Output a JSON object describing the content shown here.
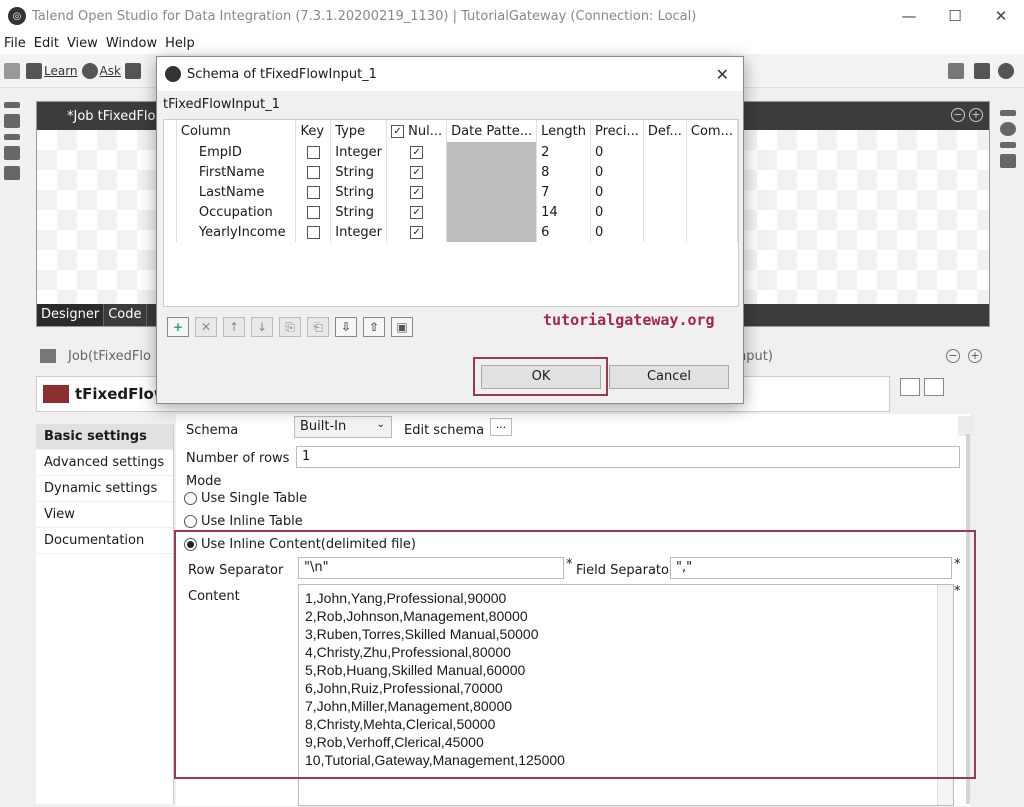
{
  "window": {
    "title": "Talend Open Studio for Data Integration (7.3.1.20200219_1130) | TutorialGateway (Connection: Local)",
    "minimize": "—",
    "maximize": "☐",
    "close": "✕"
  },
  "menu": [
    "File",
    "Edit",
    "View",
    "Window",
    "Help"
  ],
  "toolbar": {
    "learn": "Learn",
    "ask": "Ask"
  },
  "designer": {
    "tab_title": "*Job tFixedFlo",
    "tabs": [
      "Designer",
      "Code"
    ]
  },
  "component": {
    "job_label": "Job(tFixedFlo",
    "job_label_tail": "nput)",
    "title": "tFixedFlow"
  },
  "nav": [
    "Basic settings",
    "Advanced settings",
    "Dynamic settings",
    "View",
    "Documentation"
  ],
  "settings": {
    "schema_label": "Schema",
    "schema_value": "Built-In",
    "edit_schema": "Edit schema",
    "edit_schema_btn": "...",
    "rows_label": "Number of rows",
    "rows_value": "1",
    "mode_label": "Mode",
    "mode_options": [
      "Use Single Table",
      "Use Inline Table",
      "Use Inline Content(delimited file)"
    ],
    "row_sep_label": "Row Separator",
    "row_sep_value": "\"\\n\"",
    "field_sep_label": "Field Separator",
    "field_sep_value": "\",\"",
    "content_label": "Content",
    "required_mark": "*",
    "content_lines": [
      "1,John,Yang,Professional,90000",
      "2,Rob,Johnson,Management,80000",
      "3,Ruben,Torres,Skilled Manual,50000",
      "4,Christy,Zhu,Professional,80000",
      "5,Rob,Huang,Skilled Manual,60000",
      "6,John,Ruiz,Professional,70000",
      "7,John,Miller,Management,80000",
      "8,Christy,Mehta,Clerical,50000",
      "9,Rob,Verhoff,Clerical,45000",
      "10,Tutorial,Gateway,Management,125000"
    ]
  },
  "dialog": {
    "title": "Schema of tFixedFlowInput_1",
    "subtitle": "tFixedFlowInput_1",
    "close": "✕",
    "columns": [
      "Column",
      "Key",
      "Type",
      "Nul...",
      "Date Patte...",
      "Length",
      "Preci...",
      "Def...",
      "Com..."
    ],
    "rows": [
      {
        "name": "EmpID",
        "type": "Integer",
        "length": "2",
        "precision": "0"
      },
      {
        "name": "FirstName",
        "type": "String",
        "length": "8",
        "precision": "0"
      },
      {
        "name": "LastName",
        "type": "String",
        "length": "7",
        "precision": "0"
      },
      {
        "name": "Occupation",
        "type": "String",
        "length": "14",
        "precision": "0"
      },
      {
        "name": "YearlyIncome",
        "type": "Integer",
        "length": "6",
        "precision": "0"
      }
    ],
    "tools": [
      "+",
      "✕",
      "↑",
      "↓",
      "⎘",
      "⎗",
      "⇩",
      "⇧",
      "▣"
    ],
    "watermark": "tutorialgateway.org",
    "ok": "OK",
    "cancel": "Cancel"
  }
}
